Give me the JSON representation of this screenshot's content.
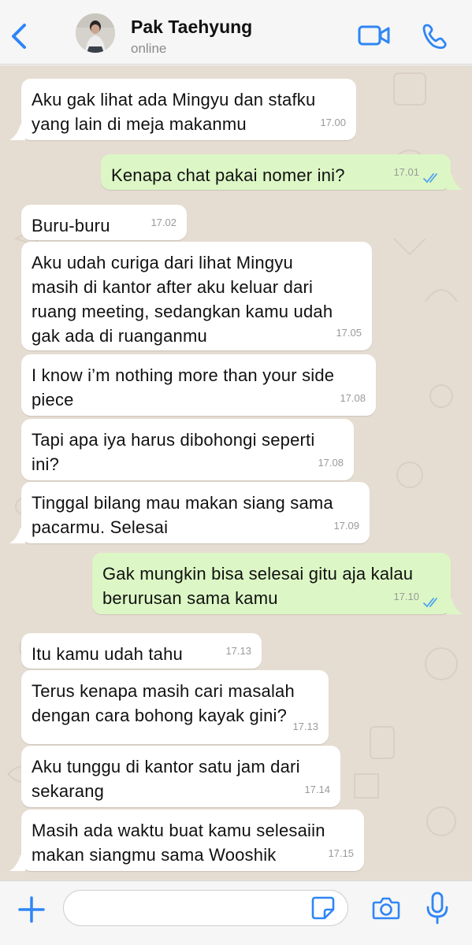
{
  "header": {
    "contact_name": "Pak Taehyung",
    "status": "online",
    "back_icon": "chevron-left-icon",
    "video_icon": "video-call-icon",
    "call_icon": "phone-icon",
    "accent": "#2f86f5"
  },
  "messages": [
    {
      "side": "in",
      "text": "Aku gak lihat ada Mingyu dan stafku\nyang lain di meja makanmu",
      "time": "17.00"
    },
    {
      "side": "out",
      "text": "Kenapa chat pakai nomer ini?",
      "time": "17.01"
    },
    {
      "side": "in",
      "text": "Buru-buru",
      "time": "17.02"
    },
    {
      "side": "in",
      "text": "Aku udah curiga dari lihat Mingyu\nmasih di kantor after aku keluar dari\nruang meeting, sedangkan kamu udah\ngak ada di ruanganmu",
      "time": "17.05"
    },
    {
      "side": "in",
      "text": "I know i’m nothing more than your side\npiece",
      "time": "17.08"
    },
    {
      "side": "in",
      "text": "Tapi apa iya harus dibohongi seperti\nini?",
      "time": "17.08"
    },
    {
      "side": "in",
      "text": "Tinggal bilang mau makan siang sama\npacarmu. Selesai",
      "time": "17.09"
    },
    {
      "side": "out",
      "text": "Gak mungkin bisa selesai gitu aja kalau\nberurusan sama kamu",
      "time": "17.10"
    },
    {
      "side": "in",
      "text": "Itu kamu udah tahu",
      "time": "17.13"
    },
    {
      "side": "in",
      "text": "Terus kenapa masih cari masalah\ndengan cara bohong kayak gini?",
      "time": "17.13"
    },
    {
      "side": "in",
      "text": "Aku tunggu di kantor satu jam dari\nsekarang",
      "time": "17.14"
    },
    {
      "side": "in",
      "text": "Masih ada waktu buat kamu selesaiin\nmakan siangmu sama Wooshik",
      "time": "17.15"
    }
  ],
  "composer": {
    "value": "",
    "icons": [
      "plus-icon",
      "sticker-icon",
      "camera-icon",
      "microphone-icon"
    ]
  },
  "colors": {
    "incoming_bubble": "#ffffff",
    "outgoing_bubble": "#dcf7c5",
    "chat_background": "#e6ddd2",
    "read_ticks": "#4fa3f0"
  }
}
